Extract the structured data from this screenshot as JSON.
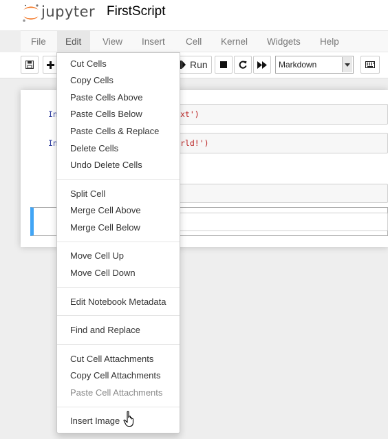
{
  "header": {
    "logo_text": "jupyter",
    "notebook_title": "FirstScript"
  },
  "menubar": {
    "items": [
      {
        "label": "File"
      },
      {
        "label": "Edit",
        "open": true
      },
      {
        "label": "View"
      },
      {
        "label": "Insert"
      },
      {
        "label": "Cell"
      },
      {
        "label": "Kernel"
      },
      {
        "label": "Widgets"
      },
      {
        "label": "Help"
      }
    ]
  },
  "toolbar": {
    "run_label": "Run",
    "cell_type": "Markdown",
    "icons": [
      "save-icon",
      "plus-icon",
      "step-forward-icon",
      "stop-icon",
      "restart-icon",
      "fast-forward-icon",
      "keyboard-icon"
    ]
  },
  "notebook": {
    "cells": [
      {
        "prompt": "In",
        "code_visible": "xt')"
      },
      {
        "prompt": "In",
        "code_visible": "rld!')"
      }
    ]
  },
  "edit_menu": {
    "groups": [
      [
        "Cut Cells",
        "Copy Cells",
        "Paste Cells Above",
        "Paste Cells Below",
        "Paste Cells & Replace",
        "Delete Cells",
        "Undo Delete Cells"
      ],
      [
        "Split Cell",
        "Merge Cell Above",
        "Merge Cell Below"
      ],
      [
        "Move Cell Up",
        "Move Cell Down"
      ],
      [
        "Edit Notebook Metadata"
      ],
      [
        "Find and Replace"
      ],
      [
        "Cut Cell Attachments",
        "Copy Cell Attachments",
        "Paste Cell Attachments"
      ],
      [
        "Insert Image"
      ]
    ],
    "disabled_items": [
      "Paste Cell Attachments"
    ]
  },
  "colors": {
    "accent_selected_cell": "#42a5f5",
    "logo_orange": "#f37726",
    "prompt_blue": "#303f9f",
    "string_red": "#ba2121"
  }
}
